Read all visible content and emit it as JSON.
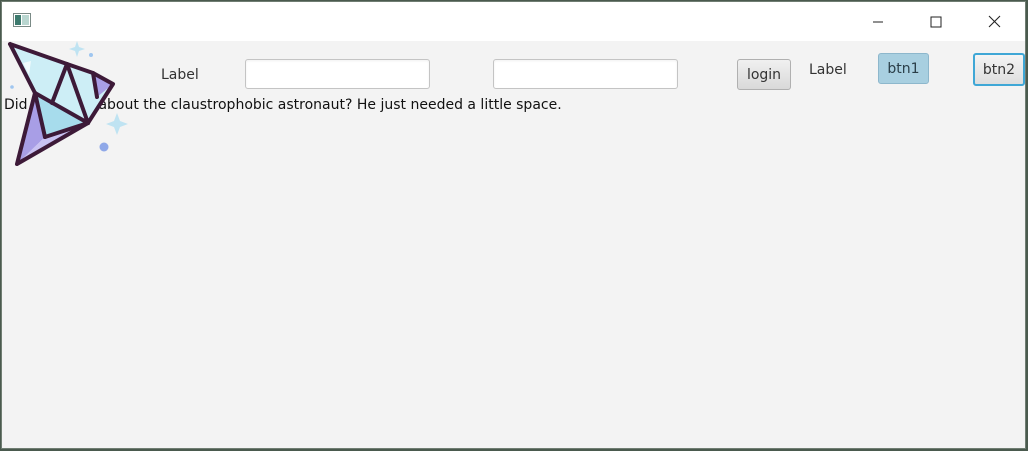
{
  "window": {
    "controls": {
      "minimize_icon": "minimize-icon",
      "maximize_icon": "maximize-icon",
      "close_icon": "close-icon"
    },
    "app_icon": "app-window-icon"
  },
  "header": {
    "label_left": "Label",
    "username_value": "",
    "password_value": "",
    "login_label": "login",
    "label_right": "Label",
    "btn1_label": "btn1",
    "btn2_label": "btn2"
  },
  "main": {
    "joke_text": "Did you hear about the claustrophobic astronaut? He just needed a little space."
  },
  "logo": {
    "name": "origami-bird-logo",
    "colors": {
      "outline": "#3d1a38",
      "light_blue": "#cdeef6",
      "mid_blue": "#a7dcec",
      "purple": "#a89ee6",
      "sparkle": "#bfe3f2",
      "dot": "#8fa8e8"
    }
  },
  "colors": {
    "btn1_bg": "#a8cfe0",
    "btn2_focus_border": "#3fa7d6",
    "window_bg": "#f3f3f3"
  }
}
